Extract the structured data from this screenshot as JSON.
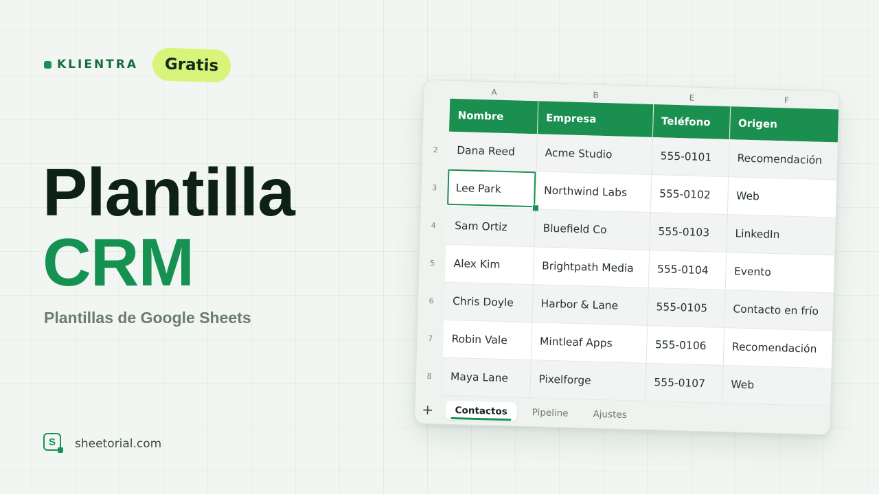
{
  "brand": {
    "name": "KLIENTRA",
    "badge": "Gratis"
  },
  "hero": {
    "title_line1": "Plantilla",
    "title_line2": "CRM",
    "subtitle": "Plantillas de Google Sheets"
  },
  "footer": {
    "logo_letter": "S",
    "url": "sheetorial.com"
  },
  "sheet": {
    "column_letters": [
      "A",
      "B",
      "E",
      "F"
    ],
    "headers": [
      "Nombre",
      "Empresa",
      "Teléfono",
      "Origen"
    ],
    "row_numbers": [
      "2",
      "3",
      "4",
      "5",
      "6",
      "7",
      "8"
    ],
    "rows": [
      [
        "Dana Reed",
        "Acme Studio",
        "555-0101",
        "Recomendación"
      ],
      [
        "Lee Park",
        "Northwind Labs",
        "555-0102",
        "Web"
      ],
      [
        "Sam Ortiz",
        "Bluefield Co",
        "555-0103",
        "LinkedIn"
      ],
      [
        "Alex Kim",
        "Brightpath Media",
        "555-0104",
        "Evento"
      ],
      [
        "Chris Doyle",
        "Harbor & Lane",
        "555-0105",
        "Contacto en frío"
      ],
      [
        "Robin Vale",
        "Mintleaf Apps",
        "555-0106",
        "Recomendación"
      ],
      [
        "Maya Lane",
        "Pixelforge",
        "555-0107",
        "Web"
      ]
    ],
    "selected_cell": "Lee Park",
    "tabs": [
      "Contactos",
      "Pipeline",
      "Ajustes"
    ],
    "active_tab": "Contactos",
    "add_tab_label": "+"
  },
  "colors": {
    "accent": "#1a9152",
    "header_bg": "#1a8f4f",
    "badge_bg": "#d8f47a",
    "title_dark": "#0e2118"
  }
}
